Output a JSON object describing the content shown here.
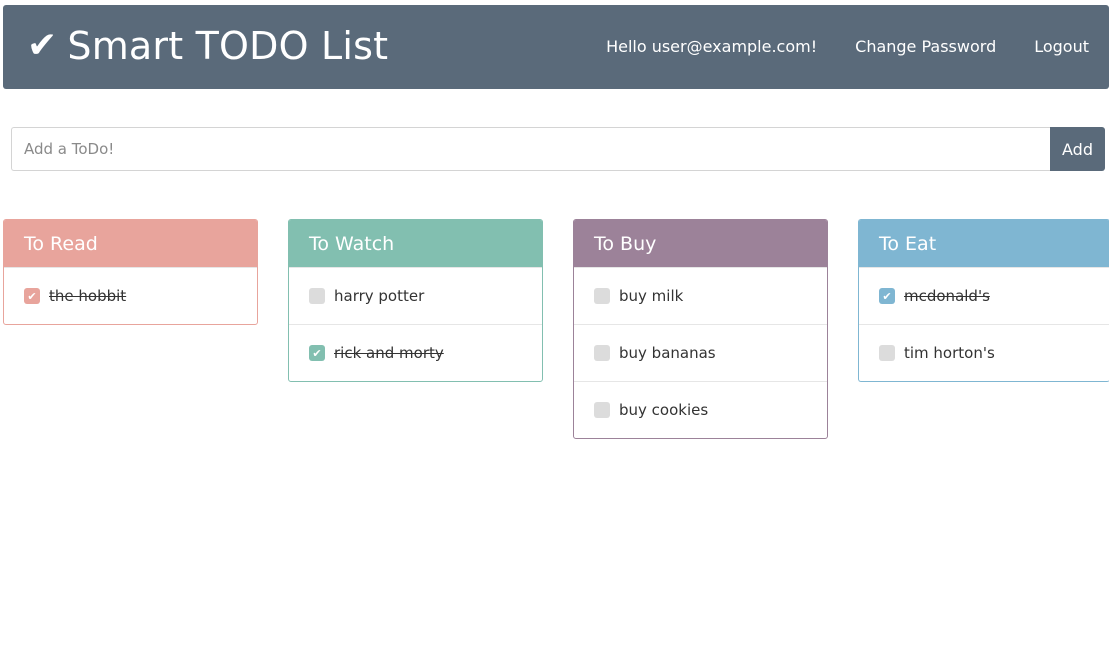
{
  "header": {
    "brand": "Smart TODO List",
    "greeting": "Hello user@example.com!",
    "change_password": "Change Password",
    "logout": "Logout",
    "bg_color": "#5a6a7a"
  },
  "add_form": {
    "placeholder": "Add a ToDo!",
    "button": "Add"
  },
  "lists": {
    "read": {
      "title": "To Read",
      "color": "#e8a49c",
      "items": [
        {
          "text": "the hobbit",
          "done": true
        }
      ]
    },
    "watch": {
      "title": "To Watch",
      "color": "#82bfb0",
      "items": [
        {
          "text": "harry potter",
          "done": false
        },
        {
          "text": "rick and morty",
          "done": true
        }
      ]
    },
    "buy": {
      "title": "To Buy",
      "color": "#9c8299",
      "items": [
        {
          "text": "buy milk",
          "done": false
        },
        {
          "text": "buy bananas",
          "done": false
        },
        {
          "text": "buy cookies",
          "done": false
        }
      ]
    },
    "eat": {
      "title": "To Eat",
      "color": "#7fb6d2",
      "items": [
        {
          "text": "mcdonald's",
          "done": true
        },
        {
          "text": "tim horton's",
          "done": false
        }
      ]
    }
  }
}
